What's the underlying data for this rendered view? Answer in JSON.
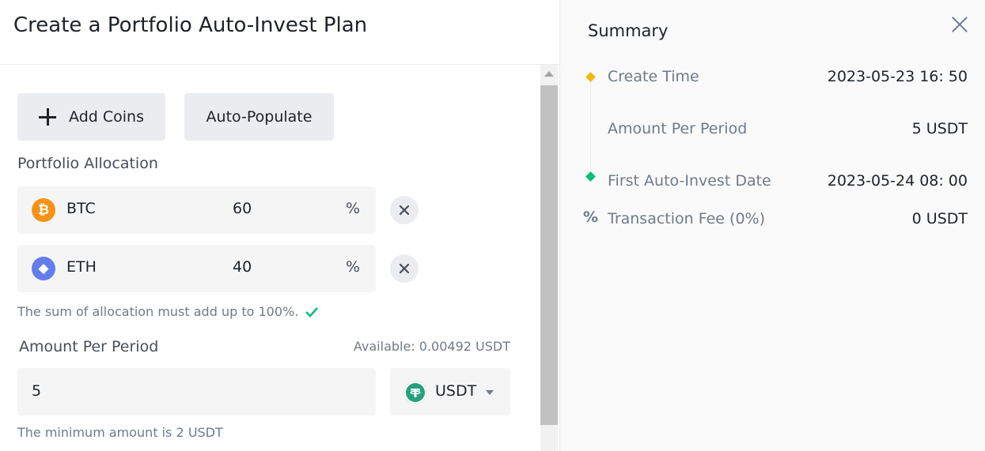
{
  "form": {
    "title": "Create a Portfolio Auto-Invest Plan",
    "add_coins_label": "Add Coins",
    "auto_populate_label": "Auto-Populate",
    "allocation_label": "Portfolio Allocation",
    "coins": [
      {
        "symbol": "BTC",
        "percent": "60",
        "unit": "%",
        "icon": "bitcoin-icon",
        "icon_glyph": "₿"
      },
      {
        "symbol": "ETH",
        "percent": "40",
        "unit": "%",
        "icon": "ethereum-icon",
        "icon_glyph": "◆"
      }
    ],
    "allocation_hint": "The sum of allocation must add up to 100%.",
    "amount_label": "Amount Per Period",
    "available": "Available: 0.00492 USDT",
    "amount_value": "5",
    "currency": "USDT",
    "minimum_hint": "The minimum amount is 2 USDT"
  },
  "summary": {
    "title": "Summary",
    "rows": [
      {
        "key": "Create Time",
        "value": "2023-05-23 16: 50"
      },
      {
        "key": "Amount Per Period",
        "value": "5 USDT"
      },
      {
        "key": "First Auto-Invest Date",
        "value": "2023-05-24 08: 00"
      },
      {
        "key": "Transaction Fee (0%)",
        "value": "0 USDT"
      }
    ]
  },
  "colors": {
    "btc": "#f7931a",
    "eth": "#627eea",
    "usdt": "#26a17b",
    "timeline_start": "#f0b90b",
    "timeline_end": "#02c076",
    "check": "#02c076"
  }
}
